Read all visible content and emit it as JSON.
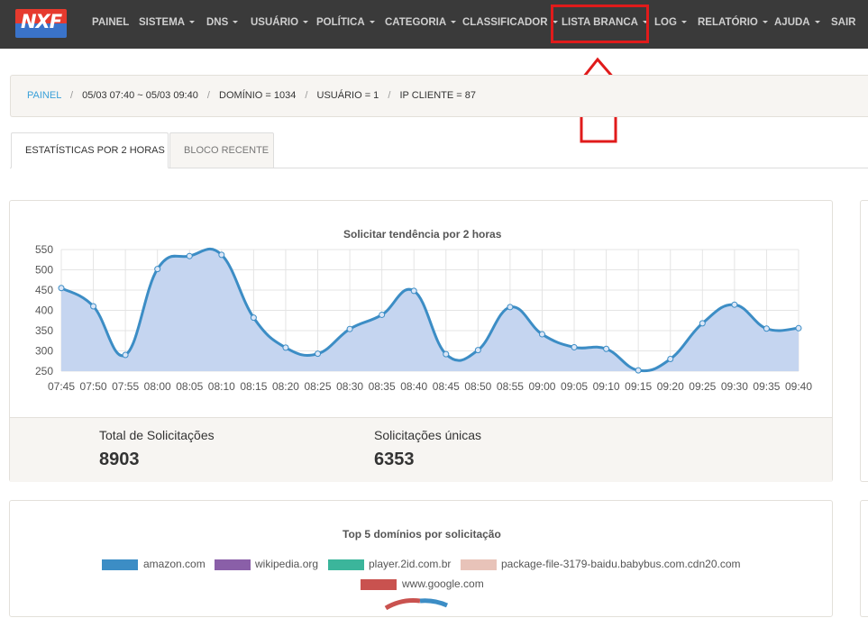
{
  "logo": {
    "text": "NXF"
  },
  "nav": {
    "items": [
      {
        "label": "PAINEL",
        "caret": false
      },
      {
        "label": "SISTEMA",
        "caret": true
      },
      {
        "label": "DNS",
        "caret": true
      },
      {
        "label": "USUÁRIO",
        "caret": true
      },
      {
        "label": "POLÍTICA",
        "caret": true
      },
      {
        "label": "CATEGORIA",
        "caret": true
      },
      {
        "label": "CLASSIFICADOR",
        "caret": true
      },
      {
        "label": "LISTA BRANCA",
        "caret": true
      },
      {
        "label": "LOG",
        "caret": true
      },
      {
        "label": "RELATÓRIO",
        "caret": true
      },
      {
        "label": "AJUDA",
        "caret": true
      },
      {
        "label": "SAIR",
        "caret": false
      }
    ],
    "highlight_color": "#e01b1b"
  },
  "breadcrumb": {
    "home": "PAINEL",
    "parts": [
      "05/03 07:40 ~ 05/03 09:40",
      "DOMÍNIO = 1034",
      "USUÁRIO = 1",
      "IP CLIENTE = 87"
    ]
  },
  "tabs": {
    "active": "ESTATÍSTICAS POR 2 HORAS",
    "inactive": "BLOCO RECENTE"
  },
  "trend": {
    "stats": {
      "total_label": "Total de Solicitações",
      "total_value": "8903",
      "unique_label": "Solicitações únicas",
      "unique_value": "6353"
    }
  },
  "chart_data": [
    {
      "type": "area",
      "title": "Solicitar tendência por 2 horas",
      "categories": [
        "07:45",
        "07:50",
        "07:55",
        "08:00",
        "08:05",
        "08:10",
        "08:15",
        "08:20",
        "08:25",
        "08:30",
        "08:35",
        "08:40",
        "08:45",
        "08:50",
        "08:55",
        "09:00",
        "09:05",
        "09:10",
        "09:15",
        "09:20",
        "09:25",
        "09:30",
        "09:35",
        "09:40"
      ],
      "values": [
        455,
        410,
        290,
        502,
        534,
        537,
        382,
        308,
        293,
        354,
        389,
        448,
        292,
        302,
        408,
        341,
        309,
        305,
        252,
        280,
        368,
        414,
        355,
        356
      ],
      "ylim": [
        250,
        550
      ],
      "yticks": [
        550,
        500,
        450,
        400,
        350,
        300,
        250
      ],
      "grid": true,
      "line_color": "#3c8dc5",
      "fill_color": "#c5d5f0"
    },
    {
      "type": "pie",
      "title": "Top 5 domínios por solicitação",
      "legend": [
        {
          "label": "amazon.com",
          "color": "#3c8dc5"
        },
        {
          "label": "wikipedia.org",
          "color": "#8a5fa8"
        },
        {
          "label": "player.2id.com.br",
          "color": "#3bb59b"
        },
        {
          "label": "package-file-3179-baidu.babybus.com.cdn20.com",
          "color": "#e8c3b9"
        },
        {
          "label": "www.google.com",
          "color": "#c9524f"
        }
      ]
    }
  ]
}
